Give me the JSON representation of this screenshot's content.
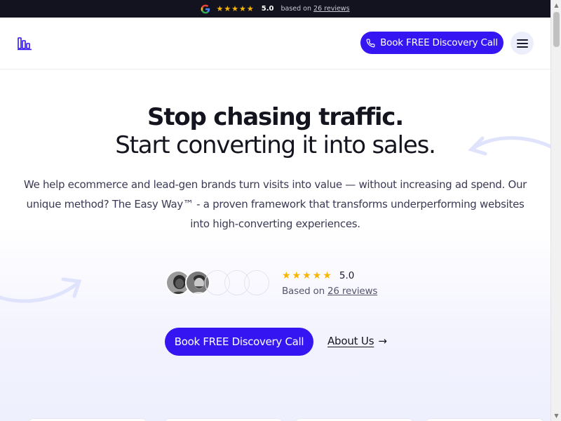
{
  "topbar": {
    "google_icon": "google-icon",
    "stars": "★★★★★",
    "rating": "5.0",
    "based_prefix": "based on",
    "reviews_link": "26 reviews"
  },
  "header": {
    "logo_icon": "bar-chart-logo",
    "cta_label": "Book FREE Discovery Call",
    "cta_icon": "phone-icon",
    "menu_icon": "hamburger-icon"
  },
  "hero": {
    "title_line1": "Stop chasing traffic.",
    "title_line2": "Start converting it into sales.",
    "description": "We help ecommerce and lead-gen brands turn visits into value — without increasing ad spend. Our unique method? The Easy Way™ - a proven framework that transforms underperforming websites into high-converting experiences.",
    "rating": {
      "stars": "★★★★★",
      "score": "5.0",
      "based_prefix": "Based on",
      "reviews_link": "26 reviews"
    },
    "cta_label": "Book FREE Discovery Call",
    "about_label": "About Us",
    "about_arrow": "→"
  },
  "colors": {
    "accent": "#3515f2",
    "topbar_bg": "#12131f",
    "star": "#f7b500",
    "decor_arrow": "#dfe3fc"
  }
}
